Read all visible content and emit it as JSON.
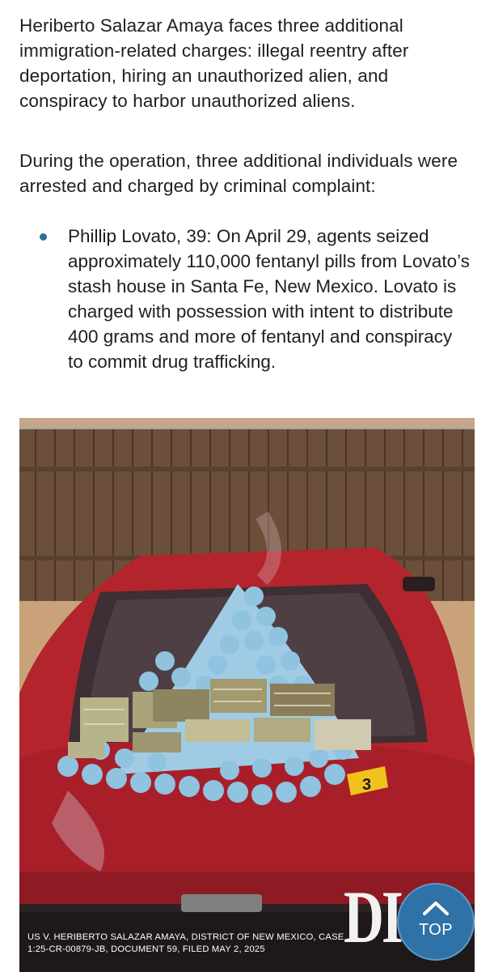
{
  "article": {
    "paragraph_1": "Heriberto Salazar Amaya faces three additional immigration-related charges: illegal reentry after deportation, hiring an unauthorized alien, and conspiracy to harbor unauthorized aliens.",
    "paragraph_2": "During the operation, three additional individuals were arrested and charged by criminal complaint:",
    "bullets": [
      "Phillip Lovato, 39: On April 29, agents seized approximately 110,000 fentanyl pills from Lovato’s stash house in Santa Fe, New Mexico. Lovato is charged with possession with intent to distribute 400 grams and more of fentanyl and conspiracy to commit drug trafficking."
    ]
  },
  "photo": {
    "evidence_marker": "3",
    "caption": "US V. HERIBERTO SALAZAR AMAYA, DISTRICT OF NEW MEXICO, CASE 1:25-CR-00879-JB, DOCUMENT 59, FILED MAY 2, 2025",
    "watermark": "DI"
  },
  "back_to_top": {
    "label": "TOP",
    "icon": "chevron-up-icon"
  },
  "colors": {
    "accent_blue": "#2e72a8",
    "bullet_blue": "#2c6e99",
    "car_red": "#b3242c"
  }
}
